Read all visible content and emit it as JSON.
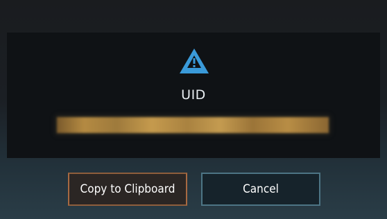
{
  "dialog": {
    "icon": "warning-triangle-icon",
    "title": "UID",
    "uid_value": ""
  },
  "buttons": {
    "copy_label": "Copy to Clipboard",
    "cancel_label": "Cancel"
  },
  "colors": {
    "accent_blue": "#3a9ad9",
    "copy_border": "#a86a42",
    "cancel_border": "#4d7585"
  }
}
